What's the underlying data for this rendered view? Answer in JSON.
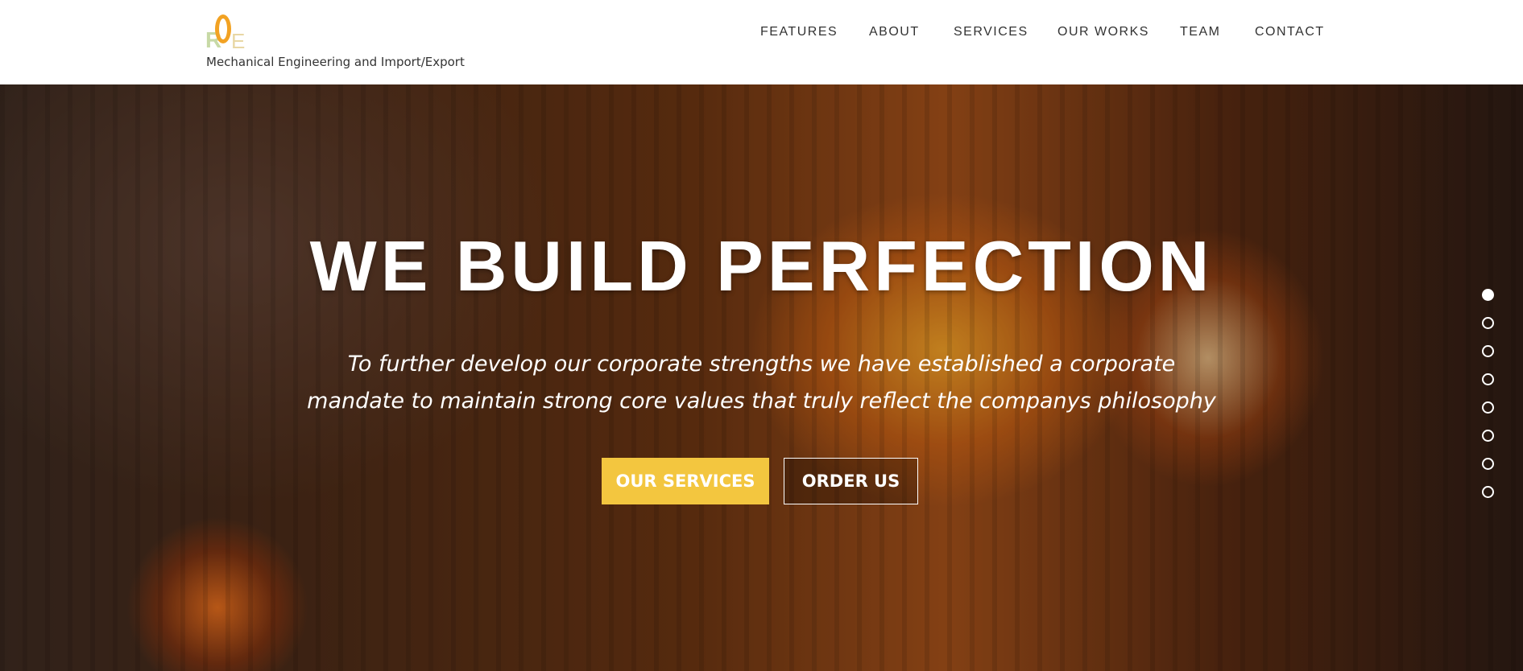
{
  "header": {
    "logo": {
      "letters": [
        "R",
        "O",
        "E"
      ],
      "colors": {
        "r": "#c7d9a6",
        "o": "#f2a223",
        "e": "#e8d7a4"
      }
    },
    "tagline": "Mechanical Engineering and Import/Export",
    "nav": [
      {
        "label": "FEATURES"
      },
      {
        "label": "ABOUT"
      },
      {
        "label": "SERVICES"
      },
      {
        "label": "OUR WORKS"
      },
      {
        "label": "TEAM"
      },
      {
        "label": "CONTACT"
      }
    ]
  },
  "hero": {
    "title": "WE BUILD PERFECTION",
    "subtitle_lines": [
      "To further develop our corporate strengths we have established a corporate",
      "mandate to maintain strong core values that truly reflect the companys philosophy"
    ],
    "primary_button": "OUR SERVICES",
    "secondary_button": "ORDER US",
    "accent_color": "#f3c63f",
    "slide_dots": {
      "count": 8,
      "active_index": 0
    }
  }
}
